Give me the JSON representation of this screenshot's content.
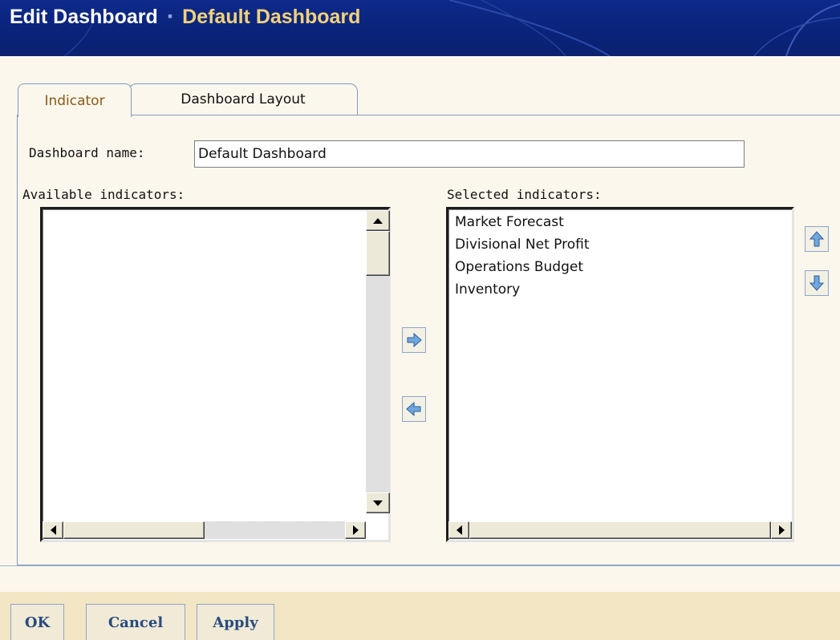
{
  "header": {
    "title": "Edit Dashboard",
    "separator": "▪",
    "subtitle": "Default Dashboard"
  },
  "tabs": [
    {
      "label": "Indicator",
      "selected": true
    },
    {
      "label": "Dashboard Layout",
      "selected": false
    }
  ],
  "form": {
    "name_label": "Dashboard name:",
    "name_value": "Default Dashboard"
  },
  "available": {
    "label": "Available indicators:",
    "items": []
  },
  "selected": {
    "label": "Selected indicators:",
    "items": [
      "Market Forecast",
      "Divisional Net Profit",
      "Operations Budget",
      "Inventory"
    ]
  },
  "icons": {
    "add": "arrow-right-icon",
    "remove": "arrow-left-icon",
    "move_up": "arrow-up-icon",
    "move_down": "arrow-down-icon"
  },
  "footer": {
    "ok_label": "OK",
    "cancel_label": "Cancel",
    "apply_label": "Apply"
  },
  "colors": {
    "header_bg": "#0d2a8a",
    "title_color": "#ffffff",
    "subtitle_color": "#f2d27a",
    "button_text": "#274c80",
    "active_tab_text": "#8a5a14"
  }
}
